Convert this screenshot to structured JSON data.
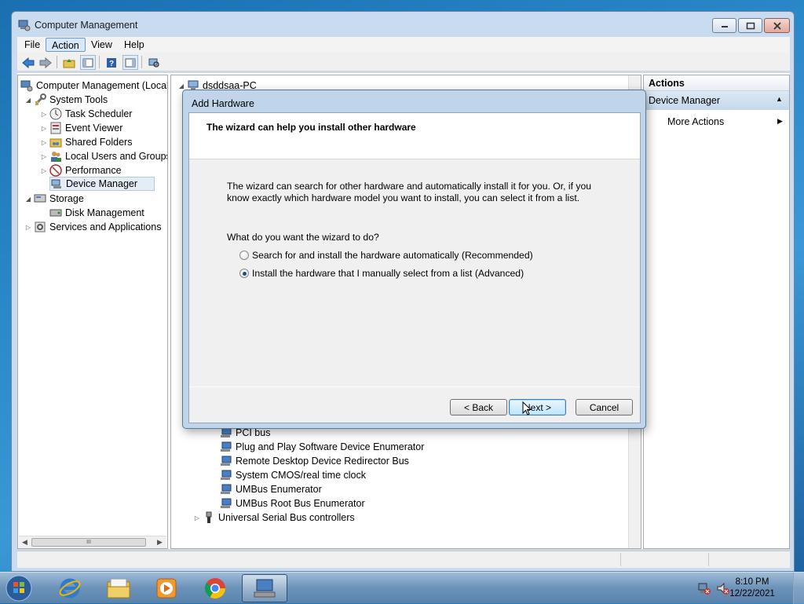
{
  "window": {
    "title": "Computer Management",
    "menus": [
      "File",
      "Action",
      "View",
      "Help"
    ]
  },
  "tree": {
    "root": "Computer Management (Local",
    "items": [
      {
        "label": "System Tools"
      },
      {
        "label": "Task Scheduler"
      },
      {
        "label": "Event Viewer"
      },
      {
        "label": "Shared Folders"
      },
      {
        "label": "Local Users and Groups"
      },
      {
        "label": "Performance"
      },
      {
        "label": "Device Manager"
      },
      {
        "label": "Storage"
      },
      {
        "label": "Disk Management"
      },
      {
        "label": "Services and Applications"
      }
    ],
    "scroll_glyph": "III"
  },
  "devices": {
    "computer": "dsddsaa-PC",
    "items": [
      "PCI bus",
      "Plug and Play Software Device Enumerator",
      "Remote Desktop Device Redirector Bus",
      "System CMOS/real time clock",
      "UMBus Enumerator",
      "UMBus Root Bus Enumerator"
    ],
    "usb": "Universal Serial Bus controllers"
  },
  "actions": {
    "header": "Actions",
    "section": "Device Manager",
    "more": "More Actions"
  },
  "dialog": {
    "title": "Add Hardware",
    "heading": "The wizard can help you install other hardware",
    "description": "The wizard can search for other hardware and automatically install it for you. Or, if you know exactly which hardware model you want to install, you can select it from a list.",
    "question": "What do you want the wizard to do?",
    "option_auto": "Search for and install the hardware automatically (Recommended)",
    "option_manual": "Install the hardware that I manually select from a list (Advanced)",
    "selected_option": "manual",
    "back": "< Back",
    "next": "Next >",
    "cancel": "Cancel"
  },
  "taskbar": {
    "time": "8:10 PM",
    "date": "12/22/2021",
    "apps": [
      "start-orb",
      "internet-explorer",
      "file-explorer",
      "media-player",
      "chrome",
      "computer-management"
    ]
  }
}
